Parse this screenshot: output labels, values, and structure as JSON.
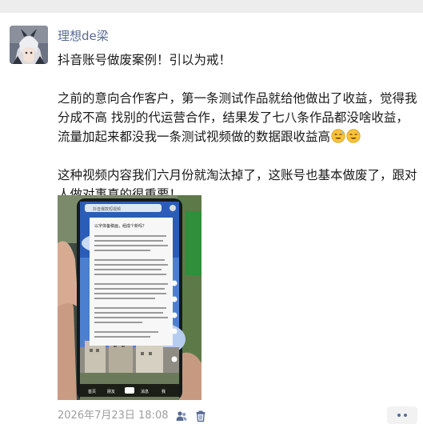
{
  "post": {
    "author": "理想de梁",
    "paragraphs": [
      "抖音账号做废案例！引以为戒！",
      "之前的意向合作客户，第一条测试作品就给他做出了收益，觉得我分成不高 找别的代运营合作，结果发了七八条作品都没啥收益，流量加起来都没我一条测试视频做的数据跟收益高",
      "这种视频内容我们六月份就淘汰掉了，这账号也基本做废了，跟对人做对事真的很重要！"
    ],
    "emoji": [
      "sweat-smile-emoji",
      "sweat-smile-emoji"
    ],
    "timestamp": "2026年7月23日 18:08",
    "icons": {
      "visibility": "people-icon",
      "delete": "trash-icon",
      "more": "more-dots-icon"
    },
    "photo": {
      "phone_top_search": "抖音爆款短视频",
      "panel_title": "以字体备稿画，组成个新吗？",
      "bottom_tabs": [
        "首页",
        "朋友",
        "消息",
        "我"
      ]
    }
  }
}
